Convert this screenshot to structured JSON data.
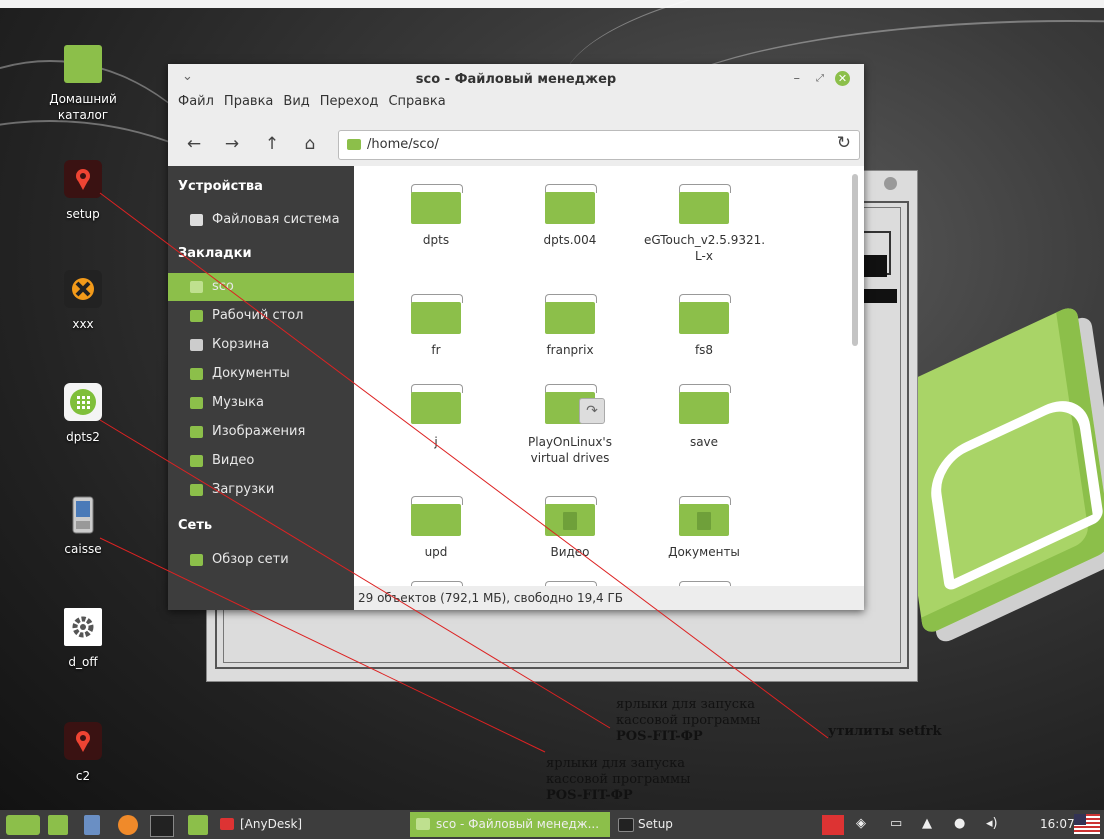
{
  "desktop": {
    "icons": [
      {
        "label": "Домашний\nкаталог",
        "icon": "home-folder-icon"
      },
      {
        "label": "setup",
        "icon": "pin-icon"
      },
      {
        "label": "xxx",
        "icon": "crossover-icon"
      },
      {
        "label": "dpts2",
        "icon": "grid-app-icon"
      },
      {
        "label": "caisse",
        "icon": "pda-icon"
      },
      {
        "label": "d_off",
        "icon": "gear-icon"
      },
      {
        "label": "c2",
        "icon": "pin-icon"
      }
    ]
  },
  "file_manager": {
    "title": "sco - Файловый менеджер",
    "menu": [
      "Файл",
      "Правка",
      "Вид",
      "Переход",
      "Справка"
    ],
    "path": "/home/sco/",
    "sidebar": {
      "devices_header": "Устройства",
      "devices": [
        "Файловая система"
      ],
      "bookmarks_header": "Закладки",
      "bookmarks": [
        "sco",
        "Рабочий стол",
        "Корзина",
        "Документы",
        "Музыка",
        "Изображения",
        "Видео",
        "Загрузки"
      ],
      "network_header": "Сеть",
      "network": [
        "Обзор сети"
      ]
    },
    "files": [
      {
        "name": "dpts"
      },
      {
        "name": "dpts.004"
      },
      {
        "name": "eGTouch_v2.5.9321.\nL-x"
      },
      {
        "name": "fr"
      },
      {
        "name": "franprix"
      },
      {
        "name": "fs8"
      },
      {
        "name": "j"
      },
      {
        "name": "PlayOnLinux's\nvirtual drives"
      },
      {
        "name": "save"
      },
      {
        "name": "upd"
      },
      {
        "name": "Видео"
      },
      {
        "name": "Документы"
      }
    ],
    "status": "29 объектов (792,1 МБ), свободно 19,4 ГБ"
  },
  "annotations": {
    "a1_line1": "ярлыки для запуска",
    "a1_line2": "кассовой программы",
    "a1_line3": "POS-FIT-ФР",
    "a2": "утилиты setfrk",
    "a3_line1": "ярлыки для запуска",
    "a3_line2": "кассовой программы",
    "a3_line3": "POS-FIT-ФР"
  },
  "taskbar": {
    "tasks": [
      "[AnyDesk]",
      "sco - Файловый менедж...",
      "Setup"
    ],
    "clock": "16:07"
  },
  "colors": {
    "accent": "#8cbf4a",
    "panel": "#3d3d3d"
  }
}
